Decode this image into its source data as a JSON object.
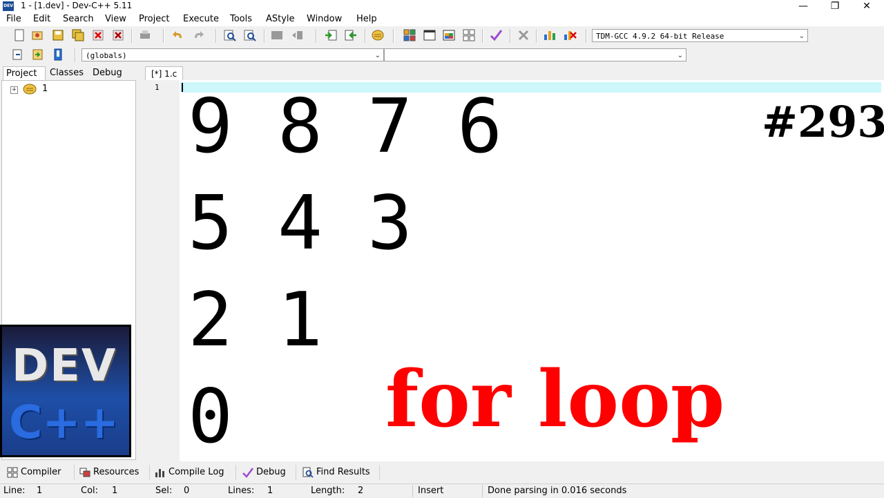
{
  "window": {
    "title": "1 - [1.dev] - Dev-C++ 5.11",
    "minimize": "—",
    "maximize": "❐",
    "close": "✕"
  },
  "menu": [
    "File",
    "Edit",
    "Search",
    "View",
    "Project",
    "Execute",
    "Tools",
    "AStyle",
    "Window",
    "Help"
  ],
  "toolbar": {
    "compiler_select": "TDM-GCC 4.9.2 64-bit Release",
    "scope_select": "(globals)",
    "member_select": ""
  },
  "left_panel": {
    "tabs": [
      "Project",
      "Classes",
      "Debug"
    ],
    "tree_root": "1"
  },
  "editor": {
    "tab_label": "[*] 1.c",
    "line_number": "1",
    "rows": [
      "9 8 7 6",
      "5 4 3",
      "2 1",
      "0"
    ]
  },
  "overlay": {
    "episode": "#293",
    "caption": "for loop",
    "logo_top": "DEV",
    "logo_bottom": "C++"
  },
  "bottom_tabs": [
    "Compiler",
    "Resources",
    "Compile Log",
    "Debug",
    "Find Results"
  ],
  "status": {
    "line_label": "Line:",
    "line_value": "1",
    "col_label": "Col:",
    "col_value": "1",
    "sel_label": "Sel:",
    "sel_value": "0",
    "lines_label": "Lines:",
    "lines_value": "1",
    "length_label": "Length:",
    "length_value": "2",
    "mode": "Insert",
    "message": "Done parsing in 0.016 seconds"
  },
  "colors": {
    "caption": "#ff0000",
    "current_line": "#ccf7fb",
    "logo_blue": "#1e4fa7"
  }
}
